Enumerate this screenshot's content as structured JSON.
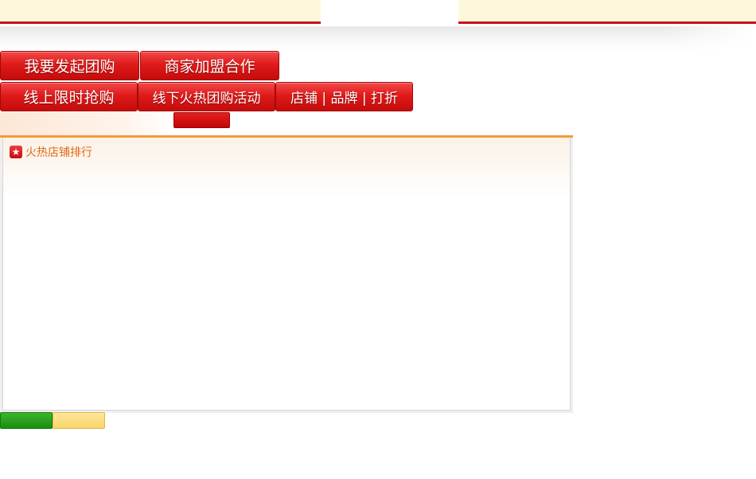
{
  "header": {},
  "nav_row1": {
    "start_group_buy": "我要发起团购",
    "merchant_join": "商家加盟合作"
  },
  "nav_row2": {
    "online_flash_sale": "线上限时抢购",
    "offline_hot_group": "线下火热团购活动",
    "shop_brand_discount": "店铺 | 品牌 | 打折"
  },
  "panel": {
    "title": "火热店铺排行",
    "icon": "star-icon"
  },
  "colors": {
    "brand_red": "#d91414",
    "accent_orange": "#f39a3c",
    "banner_bg": "#fdf8dc",
    "green_button": "#2aa31c",
    "yellow_button": "#f7d56a"
  }
}
